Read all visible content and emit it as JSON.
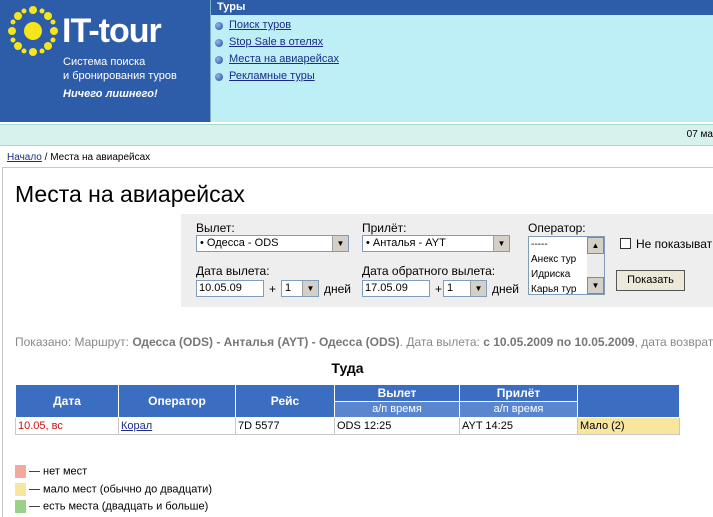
{
  "logo": {
    "title": "IT-tour",
    "subtitle_line1": "Система поиска",
    "subtitle_line2": "и бронирования туров",
    "slogan": "Ничего лишнего!"
  },
  "tours_menu": {
    "heading": "Туры",
    "items": [
      {
        "label": "Поиск туров"
      },
      {
        "label": "Stop Sale в отелях"
      },
      {
        "label": "Места на авиарейсах"
      },
      {
        "label": "Рекламные туры"
      }
    ]
  },
  "date_strip": {
    "text": "07 ма"
  },
  "breadcrumb": {
    "home": "Начало",
    "separator": " / ",
    "current": "Места на авиарейсах"
  },
  "page": {
    "title": "Места на авиарейсах"
  },
  "filter": {
    "departure_label": "Вылет:",
    "departure_value": "• Одесса - ODS",
    "arrival_label": "Прилёт:",
    "arrival_value": "• Анталья - AYT",
    "operator_label": "Оператор:",
    "operator_options": [
      "-----",
      "Анекс тур",
      "Идриска",
      "Карья тур"
    ],
    "hide_label": "Не показыват",
    "dep_date_label": "Дата вылета:",
    "dep_date_value": "10.05.09",
    "ret_date_label": "Дата обратного вылета:",
    "ret_date_value": "17.05.09",
    "plus": "+",
    "days_value": "1",
    "days_label": "дней",
    "show_button": "Показать"
  },
  "summary": {
    "prefix": "Показано: Маршрут: ",
    "route": "Одесса (ODS) - Анталья (AYT) - Одесса (ODS)",
    "mid": ". Дата вылета: ",
    "dates": "с 10.05.2009 по 10.05.2009",
    "suffix": ", дата возврат"
  },
  "section": {
    "title": "Туда"
  },
  "table": {
    "headers": {
      "date": "Дата",
      "operator": "Оператор",
      "flight": "Рейс",
      "departure": "Вылет",
      "arrival": "Прилёт",
      "dep_sub": "а/п время",
      "arr_sub": "а/п время"
    },
    "rows": [
      {
        "date": "10.05, вс",
        "operator": "Корал",
        "flight": "7D 5577",
        "departure": "ODS 12:25",
        "arrival": "AYT 14:25",
        "status": "Мало (2)"
      }
    ]
  },
  "legend": [
    {
      "color": "#f4a99c",
      "label": "— нет мест"
    },
    {
      "color": "#f8e5a0",
      "label": "— мало мест (обычно до двадцати)"
    },
    {
      "color": "#9bd08a",
      "label": "— есть места (двадцать и больше)"
    }
  ]
}
